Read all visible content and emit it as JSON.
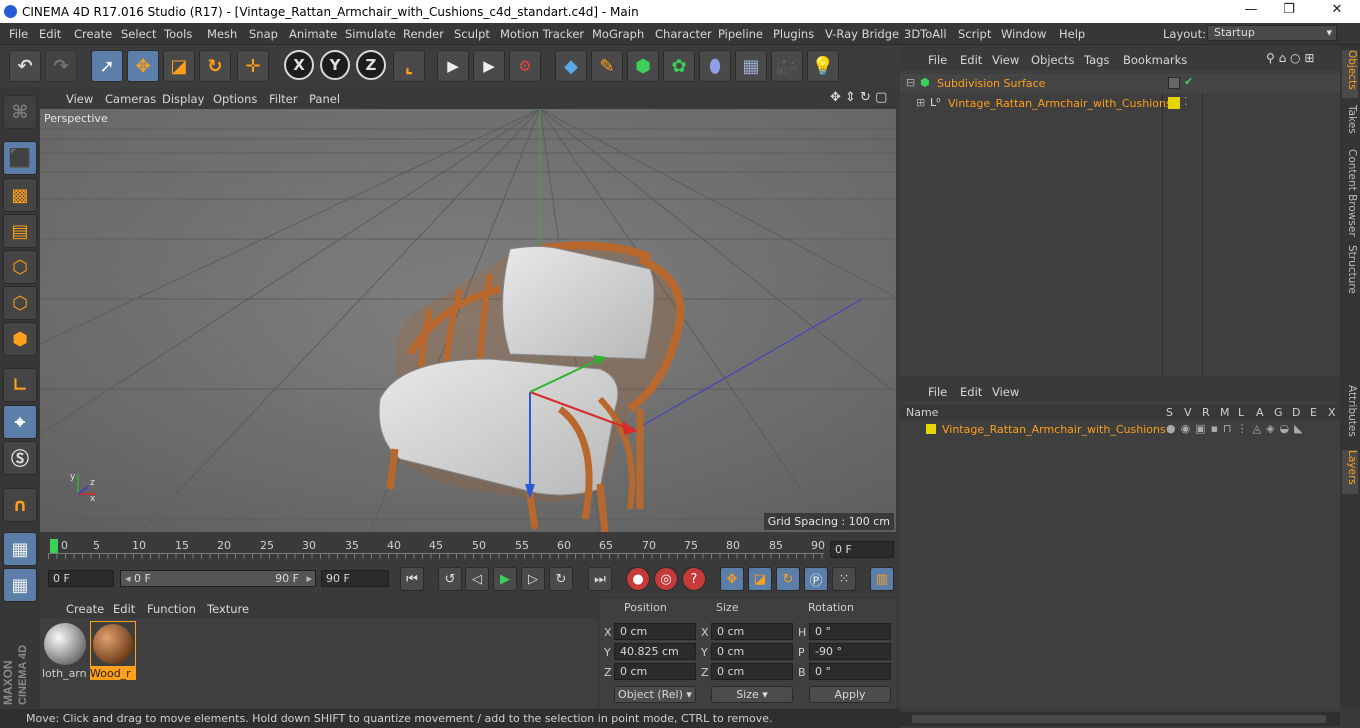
{
  "title_bar": {
    "text": "CINEMA 4D R17.016 Studio (R17) - [Vintage_Rattan_Armchair_with_Cushions_c4d_standart.c4d] - Main",
    "minimize": "—",
    "maximize": "❐",
    "close": "✕"
  },
  "menu": {
    "items": [
      "File",
      "Edit",
      "Create",
      "Select",
      "Tools",
      "Mesh",
      "Snap",
      "Animate",
      "Simulate",
      "Render",
      "Sculpt",
      "Motion Tracker",
      "MoGraph",
      "Character",
      "Pipeline",
      "Plugins",
      "V-Ray Bridge",
      "3DToAll",
      "Script",
      "Window",
      "Help"
    ],
    "layout_label": "Layout:",
    "layout_value": "Startup"
  },
  "toolbar": {
    "axis_x": "X",
    "axis_y": "Y",
    "axis_z": "Z"
  },
  "viewport": {
    "menu": [
      "View",
      "Cameras",
      "Display",
      "Options",
      "Filter",
      "Panel"
    ],
    "label": "Perspective",
    "grid_spacing": "Grid Spacing : 100 cm"
  },
  "timeline": {
    "ticks": [
      "0",
      "5",
      "10",
      "15",
      "20",
      "25",
      "30",
      "35",
      "40",
      "45",
      "50",
      "55",
      "60",
      "65",
      "70",
      "75",
      "80",
      "85",
      "90"
    ],
    "current_frame": "0 F"
  },
  "transport": {
    "start": "0 F",
    "slider_start": "0 F",
    "slider_end": "90 F",
    "end": "90 F"
  },
  "materials": {
    "menu": [
      "Create",
      "Edit",
      "Function",
      "Texture"
    ],
    "items": [
      {
        "label": "loth_arn",
        "selected": false
      },
      {
        "label": "Wood_r",
        "selected": true
      }
    ]
  },
  "coordinates": {
    "headers": {
      "position": "Position",
      "size": "Size",
      "rotation": "Rotation"
    },
    "rows": [
      {
        "pos_label": "X",
        "pos": "0 cm",
        "size_label": "X",
        "size": "0 cm",
        "rot_label": "H",
        "rot": "0 °"
      },
      {
        "pos_label": "Y",
        "pos": "40.825 cm",
        "size_label": "Y",
        "size": "0 cm",
        "rot_label": "P",
        "rot": "-90 °"
      },
      {
        "pos_label": "Z",
        "pos": "0 cm",
        "size_label": "Z",
        "size": "0 cm",
        "rot_label": "B",
        "rot": "0 °"
      }
    ],
    "mode": "Object (Rel)",
    "size_mode": "Size",
    "apply": "Apply"
  },
  "objects_panel": {
    "menu": [
      "File",
      "Edit",
      "View",
      "Objects",
      "Tags",
      "Bookmarks"
    ],
    "items": [
      {
        "name": "Subdivision Surface"
      },
      {
        "name": "Vintage_Rattan_Armchair_with_Cushions"
      }
    ]
  },
  "layers_panel": {
    "menu": [
      "File",
      "Edit",
      "View"
    ],
    "header_name": "Name",
    "header_cols": [
      "S",
      "V",
      "R",
      "M",
      "L",
      "A",
      "G",
      "D",
      "E",
      "X"
    ],
    "items": [
      {
        "name": "Vintage_Rattan_Armchair_with_Cushions"
      }
    ]
  },
  "side_tabs": [
    "Objects",
    "Takes",
    "Content Browser",
    "Structure",
    "Attributes",
    "Layers"
  ],
  "status": "Move: Click and drag to move elements. Hold down SHIFT to quantize movement / add to the selection in point mode, CTRL to remove.",
  "colors": {
    "accent": "#ff9f1a",
    "selection": "#5b7fa8",
    "layer_yellow": "#e4d400"
  }
}
